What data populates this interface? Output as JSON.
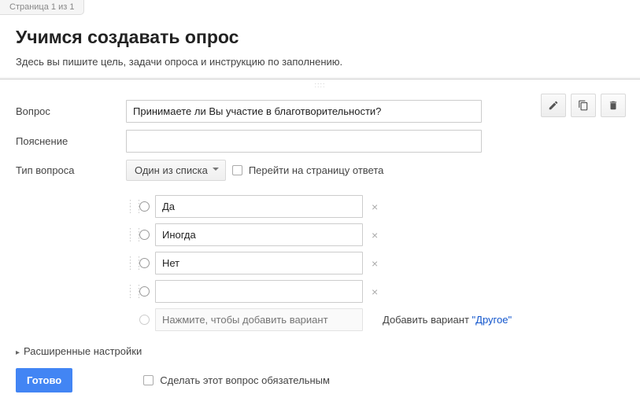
{
  "page_indicator": "Страница 1 из 1",
  "form_title": "Учимся создавать опрос",
  "form_description": "Здесь вы пишите цель, задачи опроса и инструкцию по заполнению.",
  "labels": {
    "question": "Вопрос",
    "hint": "Пояснение",
    "type": "Тип вопроса"
  },
  "question_value": "Принимаете ли Вы участие в благотворительности?",
  "hint_value": "",
  "type_value": "Один из списка",
  "goto_checkbox": {
    "checked": false,
    "label": "Перейти на страницу ответа"
  },
  "options": [
    {
      "value": "Да"
    },
    {
      "value": "Иногда"
    },
    {
      "value": "Нет"
    },
    {
      "value": ""
    }
  ],
  "add_option_placeholder": "Нажмите, чтобы добавить вариант",
  "add_other": {
    "prefix": "Добавить вариант ",
    "link": "\"Другое\""
  },
  "advanced_label": "Расширенные настройки",
  "done_button": "Готово",
  "required_checkbox": {
    "checked": false,
    "label": "Сделать этот вопрос обязательным"
  }
}
